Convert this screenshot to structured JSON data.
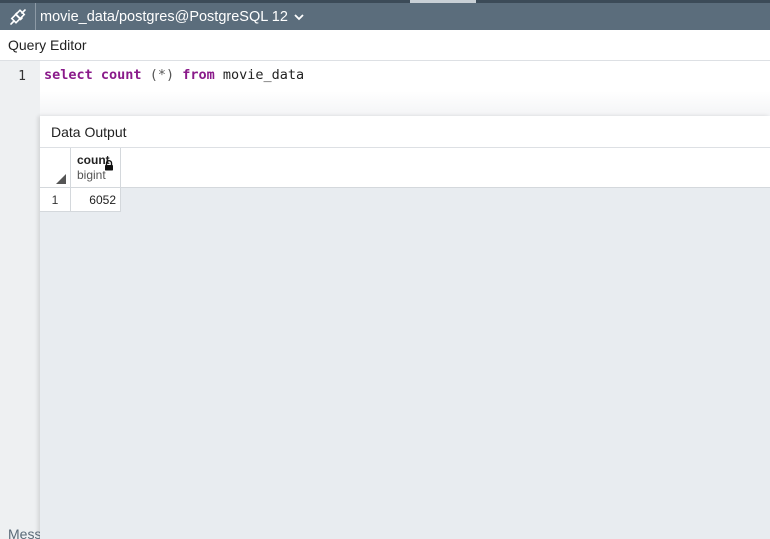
{
  "titlebar": {
    "connection": "movie_data/postgres@PostgreSQL 12",
    "icons": {
      "connection": "plug-connection-icon",
      "dropdown": "chevron-down-icon"
    }
  },
  "query_editor": {
    "title": "Query Editor",
    "line_number": "1",
    "code": {
      "kw_select": "select",
      "kw_count": "count",
      "args": "(*)",
      "kw_from": "from",
      "table": "movie_data"
    }
  },
  "data_output": {
    "title": "Data Output",
    "columns": [
      {
        "name": "count",
        "type": "bigint"
      }
    ],
    "rows": [
      {
        "row_number": "1",
        "values": [
          "6052"
        ]
      }
    ]
  },
  "bottom_tabs": {
    "messages": "Messages"
  },
  "colors": {
    "titlebar_bg": "#5b6d7c",
    "keyword": "#8a1a8a",
    "panel_bg": "#e8ecf0",
    "gutter_bg": "#eef0f2"
  }
}
